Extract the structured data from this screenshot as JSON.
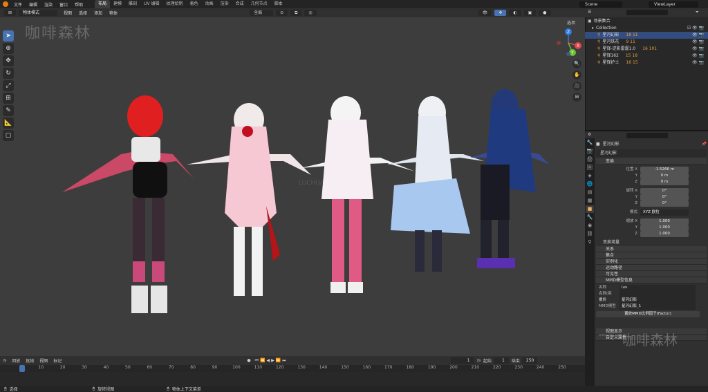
{
  "topbar": {
    "menu": [
      "文件",
      "编辑",
      "渲染",
      "窗口",
      "帮助"
    ],
    "workspaces": [
      "布局",
      "建模",
      "雕刻",
      "UV 编辑",
      "纹理绘制",
      "着色",
      "动画",
      "渲染",
      "合成",
      "几何节点",
      "脚本"
    ],
    "active_workspace": "布局",
    "scene": "Scene",
    "view_layer": "ViewLayer"
  },
  "viewport": {
    "mode": "物体模式",
    "menu": [
      "视图",
      "选择",
      "添加",
      "物体"
    ],
    "transform_orientation": "全局",
    "options_label": "选项",
    "watermark": "咖啡森林",
    "center_watermark": "LUCHUAN"
  },
  "gizmo": {
    "x": "X",
    "y": "Y",
    "z": "Z"
  },
  "outliner": {
    "root": "场景集合",
    "collection": "Collection",
    "items": [
      {
        "name": "星河幻影",
        "counts": "18 11",
        "sel": true
      },
      {
        "name": "星河铁花",
        "counts": "9 11"
      },
      {
        "name": "星铎-逆影雷霆1.0",
        "counts": "16 101"
      },
      {
        "name": "星铎162",
        "counts": "15 18"
      },
      {
        "name": "星铎护士",
        "counts": "16 15"
      }
    ]
  },
  "props": {
    "object_name": "星河幻影",
    "data_name": "星河幻影",
    "transform": "变换",
    "location": {
      "label": "位置 X",
      "x": "-1.5266 m",
      "y": "0 m",
      "z": "0 m"
    },
    "rotation": {
      "label": "旋转 X",
      "x": "0°",
      "y": "0°",
      "z": "0°"
    },
    "mode_label": "模式",
    "mode_value": "XYZ 欧拉",
    "scale": {
      "label": "缩放 X",
      "x": "1.000",
      "y": "1.000",
      "z": "1.000"
    },
    "delta": "变换增量",
    "sections": [
      "关系",
      "集合",
      "实例化",
      "运动路径",
      "可见性"
    ],
    "mmd_title": "MMD模型信息",
    "name_label": "名称",
    "name_value": "luv",
    "name_en_label": "名称(英文)",
    "root_label": "根骨",
    "root_value": "星河幻影",
    "mmd_label": "MMD模型",
    "mmd_value": "星河幻影_1",
    "factor_label": "置放MMD比例因子(Factor)",
    "bottom_sections": [
      "视图显示",
      "自定义属性"
    ],
    "watermark_big": "咖啡森林",
    "watermark_small": "www.cfsl.com"
  },
  "timeline": {
    "menu": [
      "回放",
      "抠帧",
      "视图",
      "标记"
    ],
    "current": "1",
    "start_label": "起始",
    "start": "1",
    "end_label": "结束",
    "end": "250",
    "ticks": [
      "1",
      "10",
      "20",
      "30",
      "40",
      "50",
      "60",
      "70",
      "80",
      "90",
      "100",
      "110",
      "120",
      "130",
      "140",
      "150",
      "160",
      "170",
      "180",
      "190",
      "200",
      "210",
      "220",
      "230",
      "240",
      "250"
    ]
  },
  "status": {
    "left": "选择",
    "mid": "旋转视图",
    "right": "物体上下文菜单"
  },
  "colors": {
    "accent": "#4772b3",
    "bg": "#3d3d3d",
    "orange": "#e87d0d"
  }
}
